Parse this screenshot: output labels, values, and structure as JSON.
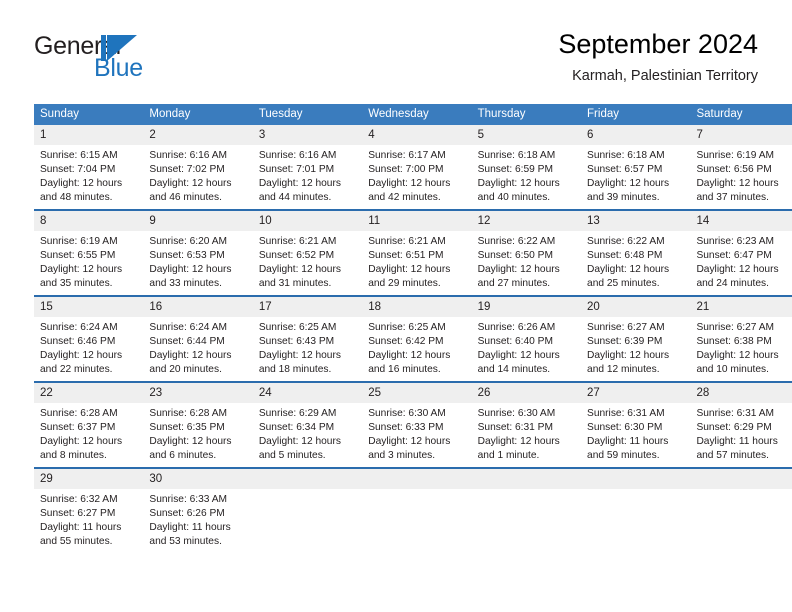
{
  "brand": {
    "name_top": "General",
    "name_bottom": "Blue",
    "mark": "triangle-logo",
    "color": "#1f74bd"
  },
  "header": {
    "title": "September 2024",
    "subtitle": "Karmah, Palestinian Territory"
  },
  "theme": {
    "header_bg": "#3a7cbe",
    "row_divider": "#2b6cad",
    "daynum_bg": "#efefef",
    "text": "#231f20"
  },
  "weekday_headers": [
    "Sunday",
    "Monday",
    "Tuesday",
    "Wednesday",
    "Thursday",
    "Friday",
    "Saturday"
  ],
  "weeks": [
    [
      {
        "day": "1",
        "sunrise": "Sunrise: 6:15 AM",
        "sunset": "Sunset: 7:04 PM",
        "daylight_1": "Daylight: 12 hours",
        "daylight_2": "and 48 minutes."
      },
      {
        "day": "2",
        "sunrise": "Sunrise: 6:16 AM",
        "sunset": "Sunset: 7:02 PM",
        "daylight_1": "Daylight: 12 hours",
        "daylight_2": "and 46 minutes."
      },
      {
        "day": "3",
        "sunrise": "Sunrise: 6:16 AM",
        "sunset": "Sunset: 7:01 PM",
        "daylight_1": "Daylight: 12 hours",
        "daylight_2": "and 44 minutes."
      },
      {
        "day": "4",
        "sunrise": "Sunrise: 6:17 AM",
        "sunset": "Sunset: 7:00 PM",
        "daylight_1": "Daylight: 12 hours",
        "daylight_2": "and 42 minutes."
      },
      {
        "day": "5",
        "sunrise": "Sunrise: 6:18 AM",
        "sunset": "Sunset: 6:59 PM",
        "daylight_1": "Daylight: 12 hours",
        "daylight_2": "and 40 minutes."
      },
      {
        "day": "6",
        "sunrise": "Sunrise: 6:18 AM",
        "sunset": "Sunset: 6:57 PM",
        "daylight_1": "Daylight: 12 hours",
        "daylight_2": "and 39 minutes."
      },
      {
        "day": "7",
        "sunrise": "Sunrise: 6:19 AM",
        "sunset": "Sunset: 6:56 PM",
        "daylight_1": "Daylight: 12 hours",
        "daylight_2": "and 37 minutes."
      }
    ],
    [
      {
        "day": "8",
        "sunrise": "Sunrise: 6:19 AM",
        "sunset": "Sunset: 6:55 PM",
        "daylight_1": "Daylight: 12 hours",
        "daylight_2": "and 35 minutes."
      },
      {
        "day": "9",
        "sunrise": "Sunrise: 6:20 AM",
        "sunset": "Sunset: 6:53 PM",
        "daylight_1": "Daylight: 12 hours",
        "daylight_2": "and 33 minutes."
      },
      {
        "day": "10",
        "sunrise": "Sunrise: 6:21 AM",
        "sunset": "Sunset: 6:52 PM",
        "daylight_1": "Daylight: 12 hours",
        "daylight_2": "and 31 minutes."
      },
      {
        "day": "11",
        "sunrise": "Sunrise: 6:21 AM",
        "sunset": "Sunset: 6:51 PM",
        "daylight_1": "Daylight: 12 hours",
        "daylight_2": "and 29 minutes."
      },
      {
        "day": "12",
        "sunrise": "Sunrise: 6:22 AM",
        "sunset": "Sunset: 6:50 PM",
        "daylight_1": "Daylight: 12 hours",
        "daylight_2": "and 27 minutes."
      },
      {
        "day": "13",
        "sunrise": "Sunrise: 6:22 AM",
        "sunset": "Sunset: 6:48 PM",
        "daylight_1": "Daylight: 12 hours",
        "daylight_2": "and 25 minutes."
      },
      {
        "day": "14",
        "sunrise": "Sunrise: 6:23 AM",
        "sunset": "Sunset: 6:47 PM",
        "daylight_1": "Daylight: 12 hours",
        "daylight_2": "and 24 minutes."
      }
    ],
    [
      {
        "day": "15",
        "sunrise": "Sunrise: 6:24 AM",
        "sunset": "Sunset: 6:46 PM",
        "daylight_1": "Daylight: 12 hours",
        "daylight_2": "and 22 minutes."
      },
      {
        "day": "16",
        "sunrise": "Sunrise: 6:24 AM",
        "sunset": "Sunset: 6:44 PM",
        "daylight_1": "Daylight: 12 hours",
        "daylight_2": "and 20 minutes."
      },
      {
        "day": "17",
        "sunrise": "Sunrise: 6:25 AM",
        "sunset": "Sunset: 6:43 PM",
        "daylight_1": "Daylight: 12 hours",
        "daylight_2": "and 18 minutes."
      },
      {
        "day": "18",
        "sunrise": "Sunrise: 6:25 AM",
        "sunset": "Sunset: 6:42 PM",
        "daylight_1": "Daylight: 12 hours",
        "daylight_2": "and 16 minutes."
      },
      {
        "day": "19",
        "sunrise": "Sunrise: 6:26 AM",
        "sunset": "Sunset: 6:40 PM",
        "daylight_1": "Daylight: 12 hours",
        "daylight_2": "and 14 minutes."
      },
      {
        "day": "20",
        "sunrise": "Sunrise: 6:27 AM",
        "sunset": "Sunset: 6:39 PM",
        "daylight_1": "Daylight: 12 hours",
        "daylight_2": "and 12 minutes."
      },
      {
        "day": "21",
        "sunrise": "Sunrise: 6:27 AM",
        "sunset": "Sunset: 6:38 PM",
        "daylight_1": "Daylight: 12 hours",
        "daylight_2": "and 10 minutes."
      }
    ],
    [
      {
        "day": "22",
        "sunrise": "Sunrise: 6:28 AM",
        "sunset": "Sunset: 6:37 PM",
        "daylight_1": "Daylight: 12 hours",
        "daylight_2": "and 8 minutes."
      },
      {
        "day": "23",
        "sunrise": "Sunrise: 6:28 AM",
        "sunset": "Sunset: 6:35 PM",
        "daylight_1": "Daylight: 12 hours",
        "daylight_2": "and 6 minutes."
      },
      {
        "day": "24",
        "sunrise": "Sunrise: 6:29 AM",
        "sunset": "Sunset: 6:34 PM",
        "daylight_1": "Daylight: 12 hours",
        "daylight_2": "and 5 minutes."
      },
      {
        "day": "25",
        "sunrise": "Sunrise: 6:30 AM",
        "sunset": "Sunset: 6:33 PM",
        "daylight_1": "Daylight: 12 hours",
        "daylight_2": "and 3 minutes."
      },
      {
        "day": "26",
        "sunrise": "Sunrise: 6:30 AM",
        "sunset": "Sunset: 6:31 PM",
        "daylight_1": "Daylight: 12 hours",
        "daylight_2": "and 1 minute."
      },
      {
        "day": "27",
        "sunrise": "Sunrise: 6:31 AM",
        "sunset": "Sunset: 6:30 PM",
        "daylight_1": "Daylight: 11 hours",
        "daylight_2": "and 59 minutes."
      },
      {
        "day": "28",
        "sunrise": "Sunrise: 6:31 AM",
        "sunset": "Sunset: 6:29 PM",
        "daylight_1": "Daylight: 11 hours",
        "daylight_2": "and 57 minutes."
      }
    ],
    [
      {
        "day": "29",
        "sunrise": "Sunrise: 6:32 AM",
        "sunset": "Sunset: 6:27 PM",
        "daylight_1": "Daylight: 11 hours",
        "daylight_2": "and 55 minutes."
      },
      {
        "day": "30",
        "sunrise": "Sunrise: 6:33 AM",
        "sunset": "Sunset: 6:26 PM",
        "daylight_1": "Daylight: 11 hours",
        "daylight_2": "and 53 minutes."
      },
      {
        "day": "",
        "sunrise": "",
        "sunset": "",
        "daylight_1": "",
        "daylight_2": ""
      },
      {
        "day": "",
        "sunrise": "",
        "sunset": "",
        "daylight_1": "",
        "daylight_2": ""
      },
      {
        "day": "",
        "sunrise": "",
        "sunset": "",
        "daylight_1": "",
        "daylight_2": ""
      },
      {
        "day": "",
        "sunrise": "",
        "sunset": "",
        "daylight_1": "",
        "daylight_2": ""
      },
      {
        "day": "",
        "sunrise": "",
        "sunset": "",
        "daylight_1": "",
        "daylight_2": ""
      }
    ]
  ]
}
